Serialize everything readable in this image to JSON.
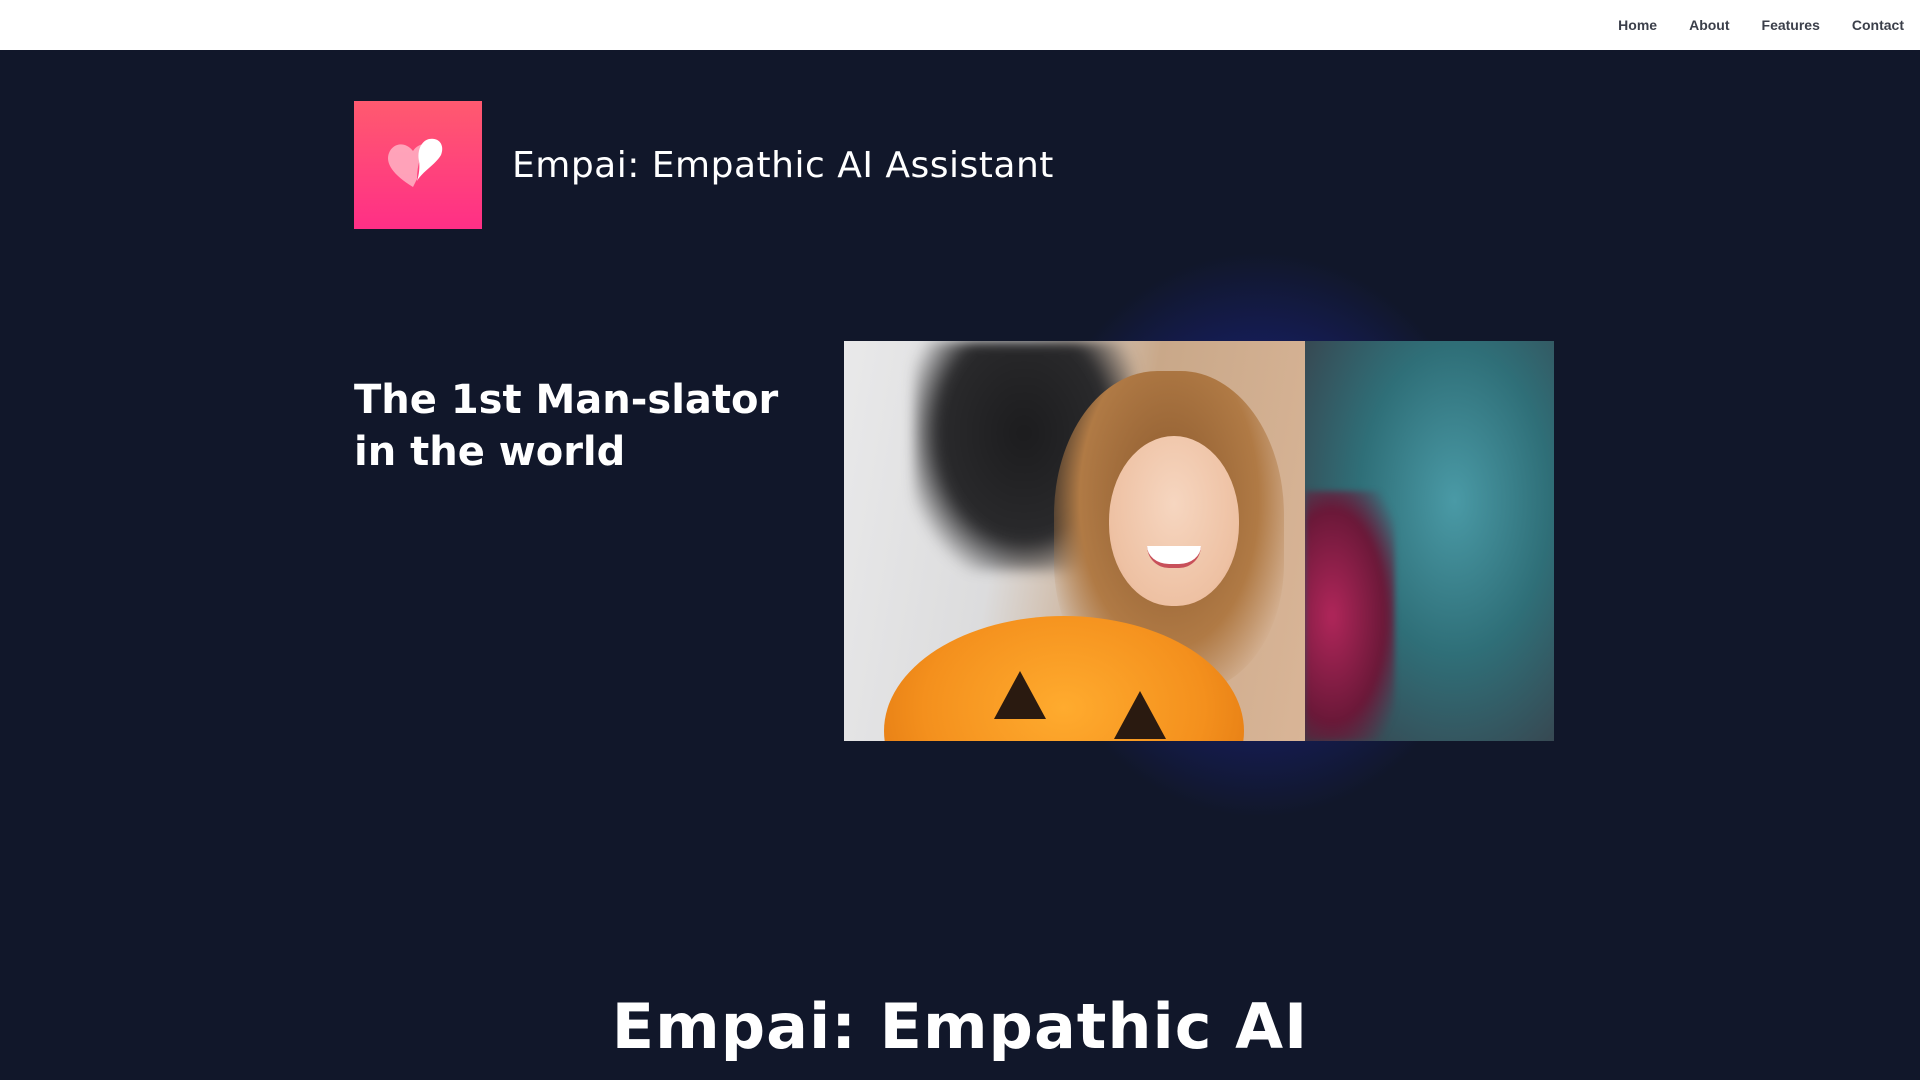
{
  "nav": {
    "items": [
      "Home",
      "About",
      "Features",
      "Contact"
    ]
  },
  "brand": {
    "title": "Empai: Empathic AI Assistant",
    "logo_icon": "heart-icon"
  },
  "hero": {
    "headline_line1": "The 1st Man-slator",
    "headline_line2": "in the world",
    "image": "halloween-photo-collage"
  },
  "section": {
    "title": "Empai: Empathic AI"
  },
  "colors": {
    "background": "#11172a",
    "topbar": "#ffffff",
    "logo_gradient_start": "#ff5a6f",
    "logo_gradient_end": "#ff2f86",
    "glow": "#2838dc"
  }
}
